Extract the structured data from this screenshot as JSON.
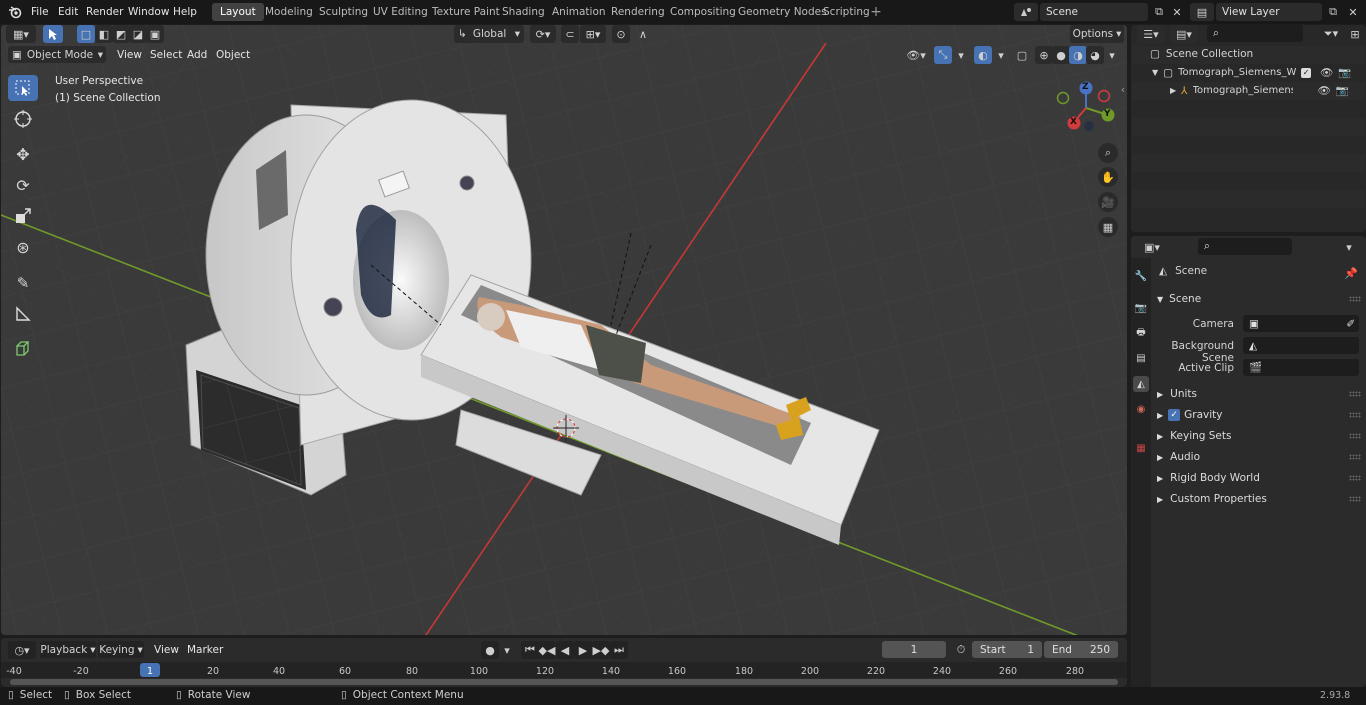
{
  "topbar": {
    "menus": [
      "File",
      "Edit",
      "Render",
      "Window",
      "Help"
    ],
    "workspaces": [
      "Layout",
      "Modeling",
      "Sculpting",
      "UV Editing",
      "Texture Paint",
      "Shading",
      "Animation",
      "Rendering",
      "Compositing",
      "Geometry Nodes",
      "Scripting"
    ],
    "active_workspace": "Layout",
    "scene": "Scene",
    "view_layer": "View Layer"
  },
  "viewport": {
    "mode": "Object Mode",
    "menus": [
      "View",
      "Select",
      "Add",
      "Object"
    ],
    "transform_orientation": "Global",
    "options_label": "Options",
    "overlay_line1": "User Perspective",
    "overlay_line2": "(1) Scene Collection",
    "gizmo": {
      "z": "Z",
      "y": "Y",
      "x": "X"
    }
  },
  "outliner": {
    "root": "Scene Collection",
    "items": [
      {
        "label": "Tomograph_Siemens_With_Pa"
      },
      {
        "label": "Tomograph_Siemens_Wit"
      }
    ]
  },
  "properties": {
    "header": "Scene",
    "section": "Scene",
    "fields": [
      {
        "label": "Camera",
        "value": ""
      },
      {
        "label": "Background Scene",
        "value": ""
      },
      {
        "label": "Active Clip",
        "value": ""
      }
    ],
    "panels": [
      "Units",
      "Gravity",
      "Keying Sets",
      "Audio",
      "Rigid Body World",
      "Custom Properties"
    ],
    "gravity_checked": true
  },
  "timeline": {
    "menus": [
      "Playback",
      "Keying",
      "View",
      "Marker"
    ],
    "current_frame": "1",
    "start_label": "Start",
    "start": "1",
    "end_label": "End",
    "end": "250",
    "ruler": [
      "-40",
      "-20",
      "1",
      "20",
      "40",
      "60",
      "80",
      "100",
      "120",
      "140",
      "160",
      "180",
      "200",
      "220",
      "240",
      "260",
      "280"
    ]
  },
  "statusbar": {
    "select": "Select",
    "box_select": "Box Select",
    "rotate_view": "Rotate View",
    "context_menu": "Object Context Menu",
    "version": "2.93.8"
  },
  "colors": {
    "accent": "#4772b3",
    "x_axis": "#d23b3b",
    "y_axis": "#6f9a29",
    "active_workspace": "#424242"
  }
}
